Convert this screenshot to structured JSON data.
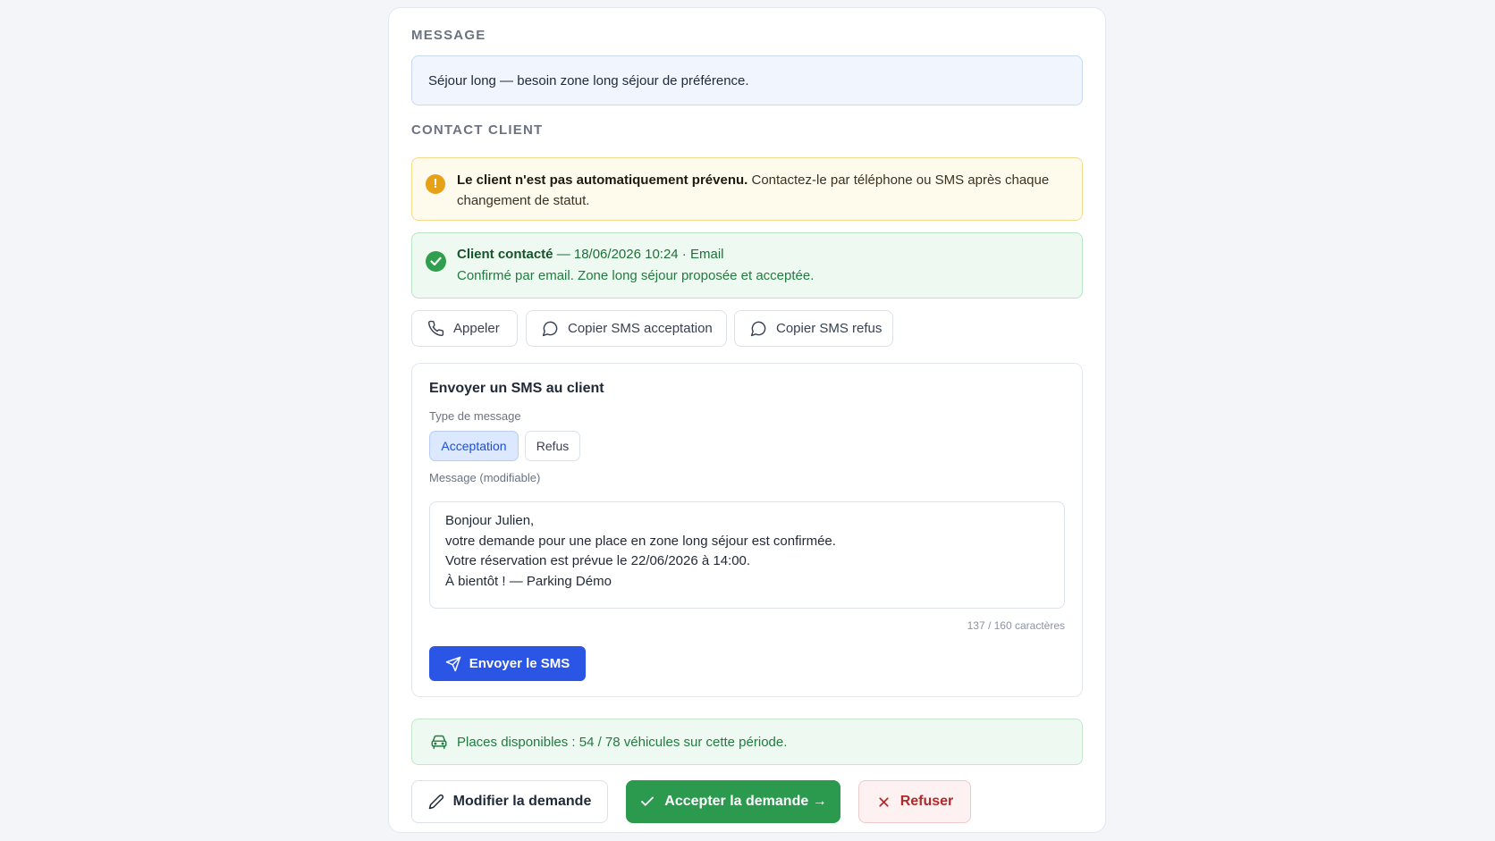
{
  "message_section": {
    "title": "MESSAGE",
    "text": "Séjour long — besoin zone long séjour de préférence."
  },
  "contact_section": {
    "title": "CONTACT CLIENT",
    "warning": {
      "bold": "Le client n'est pas automatiquement prévenu.",
      "text": " Contactez-le par téléphone ou SMS après chaque changement de statut.",
      "icon": "exclamation-icon"
    },
    "contacted": {
      "label": "Client contacté",
      "detail": " — 18/06/2026 10:24 · Email",
      "note": "Confirmé par email. Zone long séjour proposée et acceptée.",
      "icon": "check-circle-icon"
    },
    "buttons": {
      "call": "Appeler",
      "copy_accept": "Copier SMS acceptation",
      "copy_refuse": "Copier SMS refus"
    }
  },
  "sms_panel": {
    "title": "Envoyer un SMS au client",
    "type_label": "Type de message",
    "types": {
      "accept": "Acceptation",
      "refuse": "Refus"
    },
    "selected_type": "Acceptation",
    "message_label": "Message (modifiable)",
    "message": "Bonjour Julien,\nvotre demande pour une place en zone long séjour est confirmée.\nVotre réservation est prévue le 22/06/2026 à 14:00.\nÀ bientôt ! — Parking Démo",
    "char_count": "137 / 160 caractères",
    "send_label": "Envoyer le SMS"
  },
  "availability": {
    "text": "Places disponibles : 54 / 78 véhicules sur cette période.",
    "icon": "car-icon"
  },
  "actions": {
    "modify": "Modifier la demande",
    "accept": "Accepter la demande →",
    "refuse": "Refuser"
  },
  "colors": {
    "primary": "#2a55e5",
    "success": "#2c9a4e",
    "warning": "#e7a116",
    "danger": "#b02a2a"
  }
}
